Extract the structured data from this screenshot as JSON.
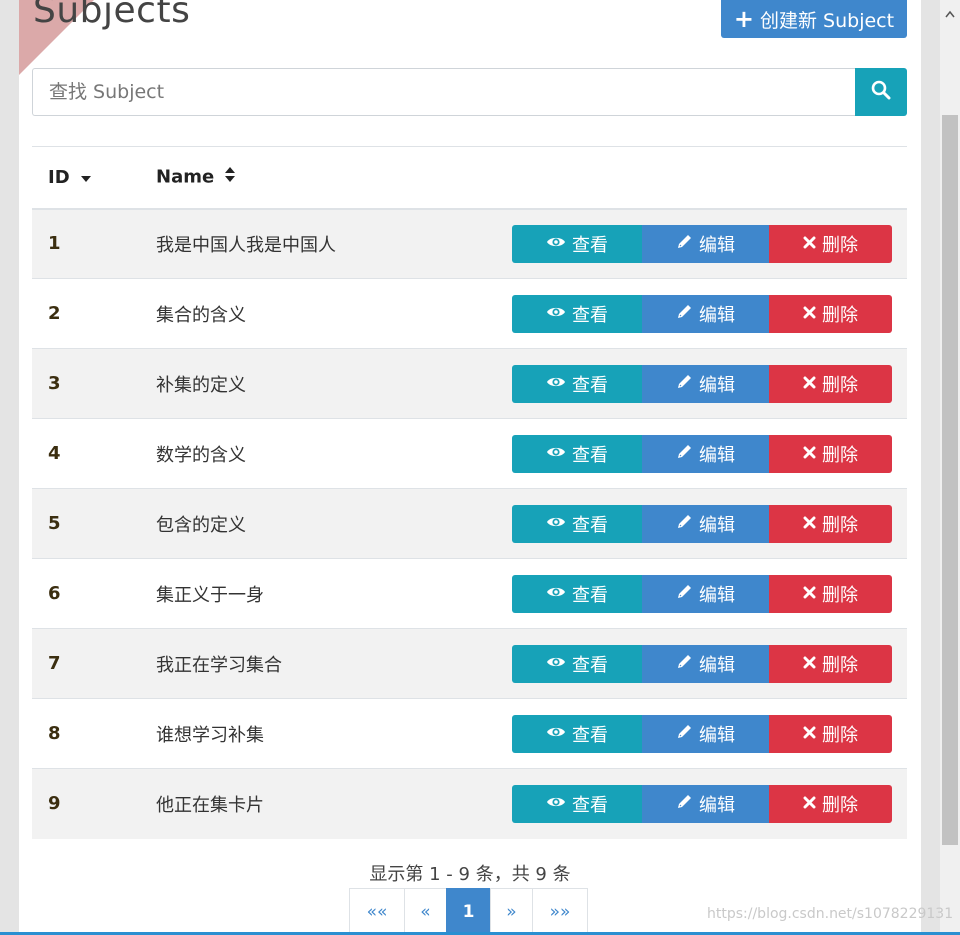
{
  "page_title": "Subjects",
  "create_button_label": "创建新 Subject",
  "search": {
    "placeholder": "查找 Subject",
    "value": ""
  },
  "table": {
    "headers": {
      "id": "ID",
      "name": "Name"
    },
    "rows": [
      {
        "id": "1",
        "name": "我是中国人我是中国人"
      },
      {
        "id": "2",
        "name": "集合的含义"
      },
      {
        "id": "3",
        "name": "补集的定义"
      },
      {
        "id": "4",
        "name": "数学的含义"
      },
      {
        "id": "5",
        "name": "包含的定义"
      },
      {
        "id": "6",
        "name": "集正义于一身"
      },
      {
        "id": "7",
        "name": "我正在学习集合"
      },
      {
        "id": "8",
        "name": "谁想学习补集"
      },
      {
        "id": "9",
        "name": "他正在集卡片"
      }
    ],
    "actions": {
      "view": "查看",
      "edit": "编辑",
      "delete": "删除"
    }
  },
  "summary_text": "显示第 1 - 9 条，共 9 条",
  "pagination": {
    "first": "««",
    "prev": "«",
    "current": "1",
    "next": "»",
    "last": "»»"
  },
  "watermark": "https://blog.csdn.net/s1078229131",
  "colors": {
    "primary": "#3f87cc",
    "info": "#17a2b8",
    "danger": "#dc3545"
  },
  "icons": {
    "create": "plus-icon",
    "search": "search-icon",
    "view": "eye-icon",
    "edit": "pencil-icon",
    "delete": "times-icon",
    "sort_id": "caret-down-icon",
    "sort_name": "sort-icon"
  }
}
